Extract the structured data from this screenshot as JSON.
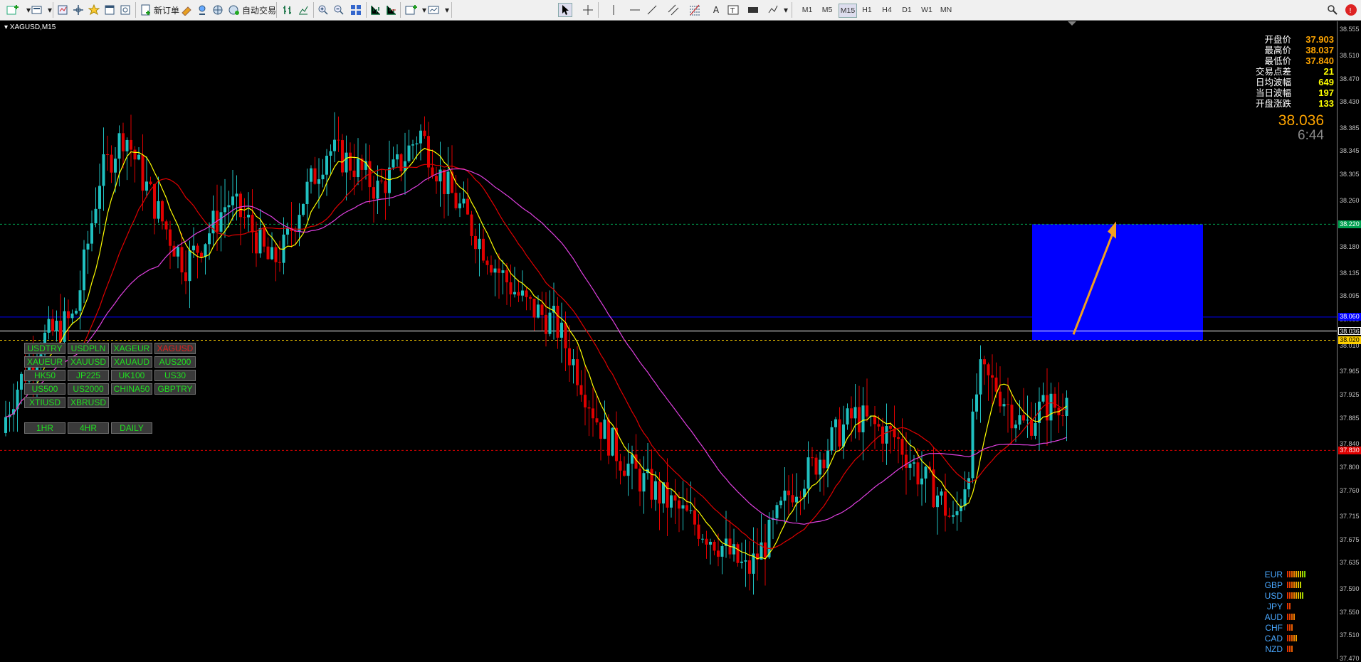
{
  "toolbar": {
    "new_order_label": "新订单",
    "auto_trade_label": "自动交易",
    "timeframes": [
      "M1",
      "M5",
      "M15",
      "H1",
      "H4",
      "D1",
      "W1",
      "MN"
    ],
    "active_timeframe": "M15"
  },
  "chart": {
    "title": "XAGUSD,M15",
    "symbol": "XAGUSD",
    "timeframe": "M15"
  },
  "info_panel": {
    "rows": [
      {
        "label": "开盘价",
        "value": "37.903",
        "color": "#ffa500"
      },
      {
        "label": "最高价",
        "value": "38.037",
        "color": "#ffa500"
      },
      {
        "label": "最低价",
        "value": "37.840",
        "color": "#ffa500"
      },
      {
        "label": "交易点差",
        "value": "21",
        "color": "#ffff00"
      },
      {
        "label": "日均波幅",
        "value": "649",
        "color": "#ffff00"
      },
      {
        "label": "当日波幅",
        "value": "197",
        "color": "#ffff00"
      },
      {
        "label": "开盘涨跌",
        "value": "133",
        "color": "#ffff00"
      }
    ],
    "current_price": "38.036",
    "countdown": "6:44"
  },
  "symbol_buttons": [
    [
      "USDTRY",
      "USDPLN",
      "XAGEUR",
      "XAGUSD"
    ],
    [
      "XAUEUR",
      "XAUUSD",
      "XAUAUD",
      "AUS200"
    ],
    [
      "HK50",
      "JP225",
      "UK100",
      "US30"
    ],
    [
      "US500",
      "US2000",
      "CHINA50",
      "GBPTRY"
    ],
    [
      "XTIUSD",
      "XBRUSD"
    ]
  ],
  "highlighted_symbol": "XAGUSD",
  "timeframe_buttons": [
    "1HR",
    "4HR",
    "DAILY"
  ],
  "currency_strength": [
    {
      "currency": "EUR",
      "level": 9
    },
    {
      "currency": "GBP",
      "level": 7
    },
    {
      "currency": "USD",
      "level": 8
    },
    {
      "currency": "JPY",
      "level": 2
    },
    {
      "currency": "AUD",
      "level": 4
    },
    {
      "currency": "CHF",
      "level": 3
    },
    {
      "currency": "CAD",
      "level": 5
    },
    {
      "currency": "NZD",
      "level": 3
    }
  ],
  "price_axis": {
    "labels": [
      "38.555",
      "38.510",
      "38.470",
      "38.430",
      "38.385",
      "38.345",
      "38.305",
      "38.260",
      "38.220",
      "38.180",
      "38.135",
      "38.095",
      "38.055",
      "38.010",
      "37.965",
      "37.925",
      "37.885",
      "37.840",
      "37.800",
      "37.760",
      "37.715",
      "37.675",
      "37.635",
      "37.590",
      "37.550",
      "37.510",
      "37.470"
    ],
    "line_tags": [
      {
        "value": "38.220",
        "color": "#00a050"
      },
      {
        "value": "38.060",
        "color": "#0000ff"
      },
      {
        "value": "38.036",
        "color": "#ffffff"
      },
      {
        "value": "38.020",
        "color": "#ffd000"
      },
      {
        "value": "37.830",
        "color": "#e00000"
      }
    ]
  },
  "chart_data": {
    "type": "candlestick",
    "symbol": "XAGUSD",
    "timeframe": "M15",
    "y_range": [
      37.47,
      38.57
    ],
    "horizontal_lines": [
      {
        "price": 38.22,
        "style": "dashed",
        "color": "#00a050"
      },
      {
        "price": 38.06,
        "style": "solid",
        "color": "#0000ff"
      },
      {
        "price": 38.036,
        "style": "solid",
        "color": "#ffffff"
      },
      {
        "price": 38.02,
        "style": "dashed",
        "color": "#ffd000"
      },
      {
        "price": 37.83,
        "style": "dashed",
        "color": "#e00000"
      }
    ],
    "target_box": {
      "price_top": 38.22,
      "price_bottom": 38.02,
      "color": "#0000ff"
    },
    "moving_averages": [
      {
        "color": "#ffff00"
      },
      {
        "color": "#e00000"
      },
      {
        "color": "#e040e0"
      }
    ],
    "up_color": "#20c0c0",
    "down_color": "#e00000"
  }
}
